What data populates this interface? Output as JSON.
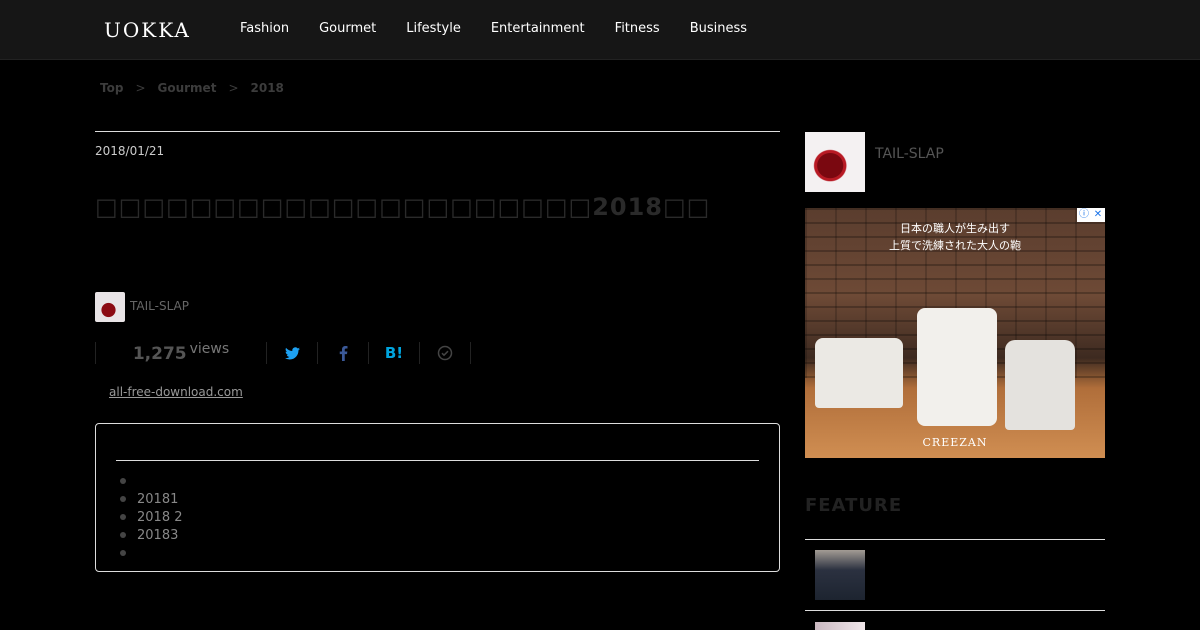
{
  "header": {
    "logo": "UOKKA",
    "nav": [
      "Fashion",
      "Gourmet",
      "Lifestyle",
      "Entertainment",
      "Fitness",
      "Business"
    ]
  },
  "breadcrumb": [
    "Top",
    ">",
    "Gourmet",
    ">",
    "2018"
  ],
  "article": {
    "date": "2018/01/21",
    "title": "□□□□□□□□□□□□□□□□□□□□□2018□□",
    "author": "TAIL-SLAP",
    "views_count": "1,275",
    "views_label": "views",
    "share": {
      "twitter": "twitter-icon",
      "facebook": "facebook-icon",
      "hatena": "B!",
      "pocket": "check-circle-icon"
    },
    "credit": "all-free-download.com",
    "toc": [
      "",
      "20181",
      "2018 2",
      "20183",
      ""
    ]
  },
  "sidebar": {
    "author": "TAIL-SLAP",
    "ad": {
      "line1": "日本の職人が生み出す",
      "line2": "上質で洗練された大人の鞄",
      "brand": "CREEZAN"
    },
    "feature_title": "FEATURE"
  },
  "colors": {
    "twitter": "#1da1f2",
    "facebook": "#3b5998",
    "hatena": "#00a4de"
  }
}
